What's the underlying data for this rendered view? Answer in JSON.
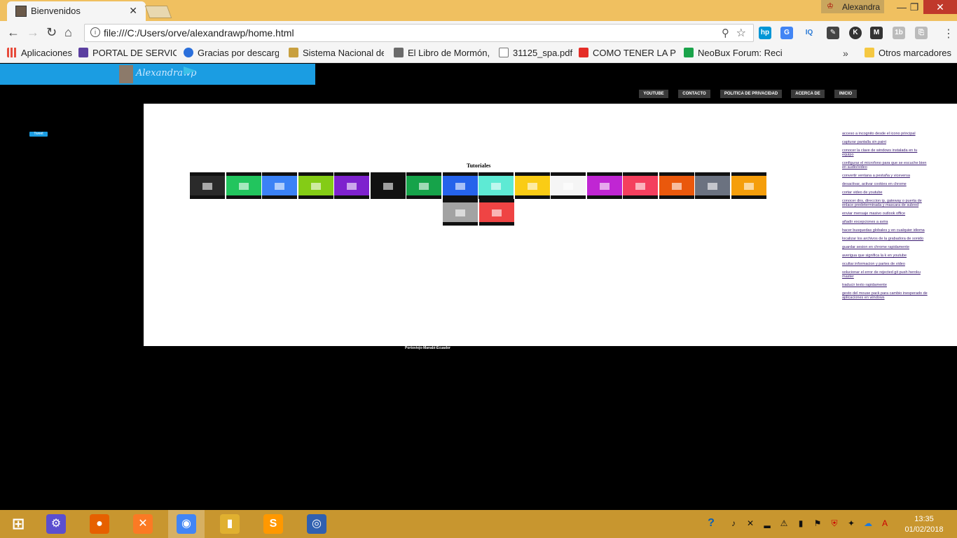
{
  "browser": {
    "tab_title": "Bienvenidos",
    "profile_name": "Alexandra",
    "url": "file:///C:/Users/orve/alexandrawp/home.html",
    "bookmarks": [
      {
        "label": "Aplicaciones",
        "color": "#e74c3c"
      },
      {
        "label": "PORTAL DE SERVICIO",
        "color": "#5b3fa0"
      },
      {
        "label": "Gracias por descarga",
        "color": "#2a6fdb"
      },
      {
        "label": "Sistema Nacional de",
        "color": "#c8a040"
      },
      {
        "label": "El Libro de Mormón,",
        "color": "#6b6b6b"
      },
      {
        "label": "31125_spa.pdf",
        "color": "#999999"
      },
      {
        "label": "COMO TENER LA PLA",
        "color": "#e52d27"
      },
      {
        "label": "NeoBux Forum: Recib",
        "color": "#1aa34a"
      }
    ],
    "other_bookmarks": "Otros marcadores",
    "more_symbol": "»"
  },
  "site": {
    "logo_text": "Alexandrawp",
    "nav": [
      {
        "label": "YOUTUBE"
      },
      {
        "label": "CONTACTO"
      },
      {
        "label": "POLITICA DE PRIVACIDAD"
      },
      {
        "label": "ACERCA DE"
      },
      {
        "label": "INICIO"
      }
    ],
    "tweet_label": "Tweet",
    "section_title": "Tutoriales",
    "thumbnails": [
      {
        "color": "#2a2a2a"
      },
      {
        "color": "#22c55e"
      },
      {
        "color": "#3b82f6"
      },
      {
        "color": "#84cc16"
      },
      {
        "color": "#7e22ce"
      },
      {
        "color": "#111111"
      },
      {
        "color": "#16a34a"
      },
      {
        "color": "#2563eb"
      },
      {
        "color": "#5eead4"
      },
      {
        "color": "#facc15"
      },
      {
        "color": "#f5f5f5"
      },
      {
        "color": "#c026d3"
      },
      {
        "color": "#f43f5e"
      },
      {
        "color": "#ea580c"
      },
      {
        "color": "#6b7280"
      },
      {
        "color": "#f59e0b"
      },
      {
        "color": "#a3a3a3"
      },
      {
        "color": "#ef4444"
      }
    ],
    "side_links": [
      "acceso a incognito desde el icono principal",
      "capturar pantalla sin paint",
      "conocer la clave de windows instalada en tu equipo",
      "configurar el microfono para que se escuche bien en audio/video",
      "convertir ventana a pestaña y viceversa",
      "desactivar, activar cookies en chrome",
      "cortar video de youtube",
      "conocer dns, direccion ip, gateway o puerta de enlace predeterminada y mascara de subred",
      "enviar mensaje masivo outlook office",
      "añadir excepciones a avira",
      "hacer busquedas globales y en cualquier idioma",
      "localizar los archivos de la grabadora de sonido",
      "guardar sesion en chrome rapidamente",
      "averigua que significa la k en youtube",
      "ocultar informacion y partes de video",
      "solucionar el error de rejected git push heroku master",
      "traducir texto rapidamente",
      "gesto del mouse pack para cambio inesperado de aplicaciones en windows"
    ],
    "footer": "Portoviejo-Manabí-Ecuador"
  },
  "taskbar": {
    "apps": [
      {
        "name": "settings",
        "color": "#5b4fcf",
        "glyph": "⚙"
      },
      {
        "name": "firefox",
        "color": "#e66000",
        "glyph": "●"
      },
      {
        "name": "xampp",
        "color": "#fb7a24",
        "glyph": "✕"
      },
      {
        "name": "chrome",
        "color": "#4285f4",
        "glyph": "◉"
      },
      {
        "name": "file-explorer",
        "color": "#e0b030",
        "glyph": "▮"
      },
      {
        "name": "sublime-text",
        "color": "#ff9800",
        "glyph": "S"
      },
      {
        "name": "other-app",
        "color": "#3060b0",
        "glyph": "◎"
      }
    ],
    "time": "13:35",
    "date": "01/02/2018"
  }
}
